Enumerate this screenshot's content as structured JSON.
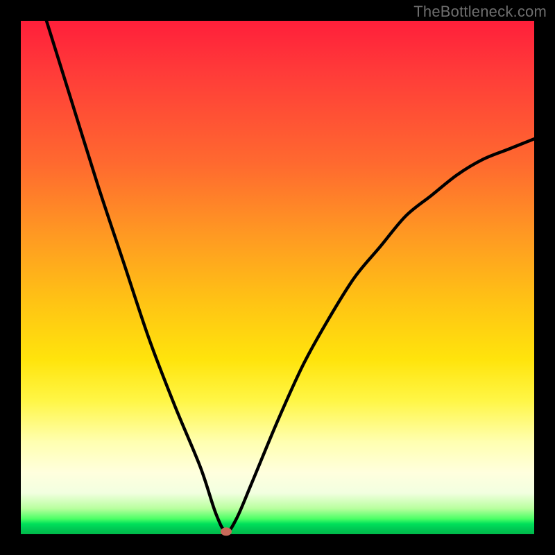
{
  "watermark": "TheBottleneck.com",
  "chart_data": {
    "type": "line",
    "title": "",
    "xlabel": "",
    "ylabel": "",
    "xlim": [
      0,
      100
    ],
    "ylim": [
      0,
      100
    ],
    "grid": false,
    "legend": false,
    "series": [
      {
        "name": "bottleneck-curve",
        "x": [
          5,
          10,
          15,
          20,
          25,
          30,
          35,
          38,
          40,
          42,
          45,
          50,
          55,
          60,
          65,
          70,
          75,
          80,
          85,
          90,
          95,
          100
        ],
        "values": [
          100,
          84,
          68,
          53,
          38,
          25,
          13,
          4,
          0.5,
          3,
          10,
          22,
          33,
          42,
          50,
          56,
          62,
          66,
          70,
          73,
          75,
          77
        ]
      }
    ],
    "minimum_point": {
      "x": 40,
      "y": 0.5
    },
    "background_gradient": {
      "top": "#ff1f3a",
      "mid": "#ffe40c",
      "bottom": "#00b84a"
    }
  }
}
